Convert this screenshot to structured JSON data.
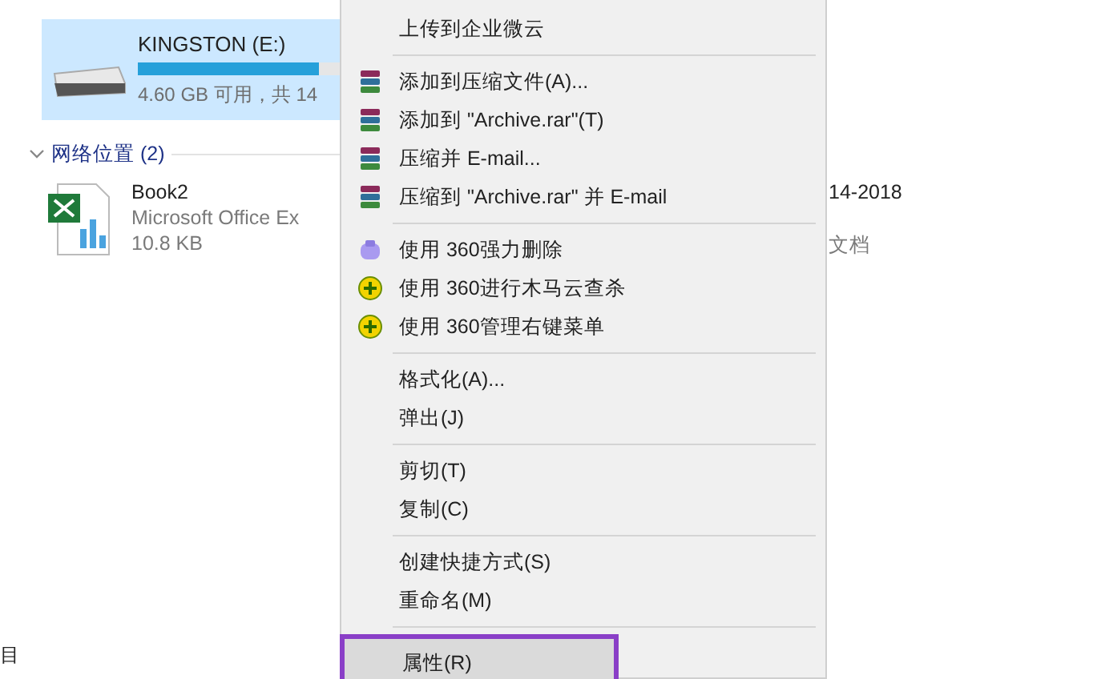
{
  "explorer": {
    "drive": {
      "name": "KINGSTON (E:)",
      "free_text": "4.60 GB 可用，共 14",
      "level": 0.9,
      "selected": true
    },
    "section": {
      "title": "网络位置 (2)",
      "expanded": true
    },
    "file": {
      "name": "Book2",
      "type": "Microsoft Office Ex",
      "size": "10.8 KB"
    },
    "right_column": {
      "date": "14-2018",
      "type": "文档"
    },
    "status_bar": "目"
  },
  "context_menu": {
    "groups": [
      [
        {
          "label": "上传到企业微云",
          "kind": "plain",
          "selected": false
        }
      ],
      [
        {
          "label": "添加到压缩文件(A)...",
          "kind": "archive",
          "selected": false
        },
        {
          "label": "添加到 \"Archive.rar\"(T)",
          "kind": "archive",
          "selected": false
        },
        {
          "label": "压缩并 E-mail...",
          "kind": "archive",
          "selected": false
        },
        {
          "label": "压缩到 \"Archive.rar\" 并 E-mail",
          "kind": "archive",
          "selected": false
        }
      ],
      [
        {
          "label": "使用 360强力删除",
          "kind": "eraser",
          "selected": false
        },
        {
          "label": "使用 360进行木马云查杀",
          "kind": "guard",
          "selected": false
        },
        {
          "label": "使用 360管理右键菜单",
          "kind": "guard",
          "selected": false
        }
      ],
      [
        {
          "label": "格式化(A)...",
          "kind": "plain",
          "selected": false
        },
        {
          "label": "弹出(J)",
          "kind": "plain",
          "selected": false
        }
      ],
      [
        {
          "label": "剪切(T)",
          "kind": "plain",
          "selected": false
        },
        {
          "label": "复制(C)",
          "kind": "plain",
          "selected": false
        }
      ],
      [
        {
          "label": "创建快捷方式(S)",
          "kind": "plain",
          "selected": false
        },
        {
          "label": "重命名(M)",
          "kind": "plain",
          "selected": false
        }
      ],
      [
        {
          "label": "属性(R)",
          "kind": "plain",
          "selected": true
        }
      ]
    ]
  }
}
